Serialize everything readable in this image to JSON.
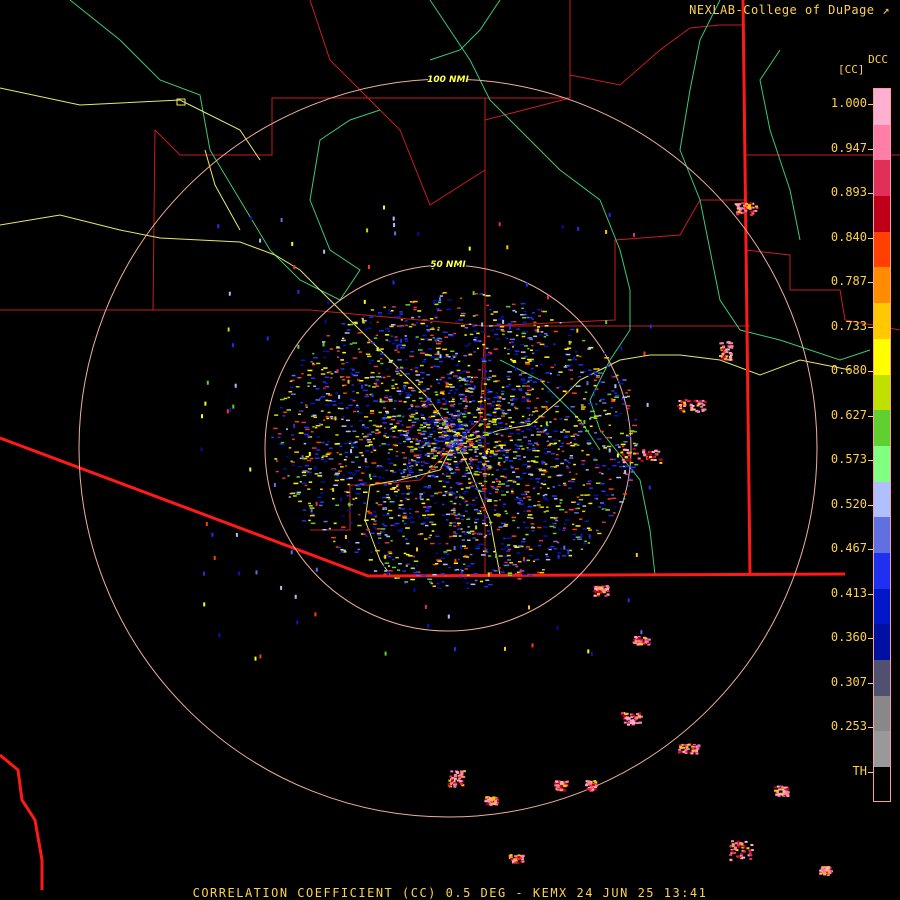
{
  "header": {
    "credit": "NEXLAB-College of DuPage"
  },
  "footer": {
    "caption": "CORRELATION COEFFICIENT (CC) 0.5 DEG - KEMX 24 JUN 25 13:41"
  },
  "map": {
    "range_rings": [
      {
        "label": "50 NMI"
      },
      {
        "label": "100 NMI"
      }
    ],
    "colors": {
      "county_lines": "#c81e1e",
      "state_border": "#ff1a1a",
      "rivers": "#3ec878",
      "highways": "#e8e86a",
      "rings": "#f0b0a0"
    }
  },
  "legend": {
    "product": "DCC",
    "unit": "[CC]",
    "ticks": [
      "1.000",
      "0.947",
      "0.893",
      "0.840",
      "0.787",
      "0.733",
      "0.680",
      "0.627",
      "0.573",
      "0.520",
      "0.467",
      "0.413",
      "0.360",
      "0.307",
      "0.253",
      "TH"
    ],
    "colors": [
      "#ffb0d0",
      "#ff7fa8",
      "#e0305a",
      "#c00018",
      "#ff4000",
      "#ff8c00",
      "#ffc800",
      "#ffff00",
      "#c0e000",
      "#60d030",
      "#80ff80",
      "#b0c0ff",
      "#6070e0",
      "#2030f0",
      "#0018c8",
      "#0010a0",
      "#505070",
      "#888888",
      "#999999",
      "#000000"
    ]
  }
}
